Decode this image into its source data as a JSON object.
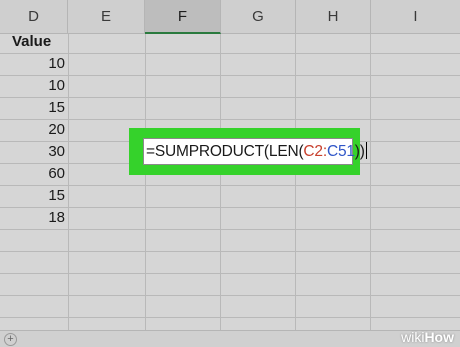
{
  "columns": [
    "D",
    "E",
    "F",
    "G",
    "H",
    "I"
  ],
  "selected_column": "F",
  "column_d": {
    "header": "Value",
    "values": [
      "10",
      "10",
      "15",
      "20",
      "30",
      "60",
      "15",
      "18"
    ]
  },
  "formula": {
    "prefix": "=SUMPRODUCT(LEN(",
    "ref_start": "C2",
    "separator": ":",
    "ref_end": "C51",
    "suffix": "))"
  },
  "bottom_bar": {
    "add_sheet_symbol": "+"
  },
  "watermark": {
    "part1": "wiki",
    "part2": "How"
  },
  "colors": {
    "highlight": "#35d22b",
    "ref1": "#c8402d",
    "ref2": "#2f56c8"
  }
}
